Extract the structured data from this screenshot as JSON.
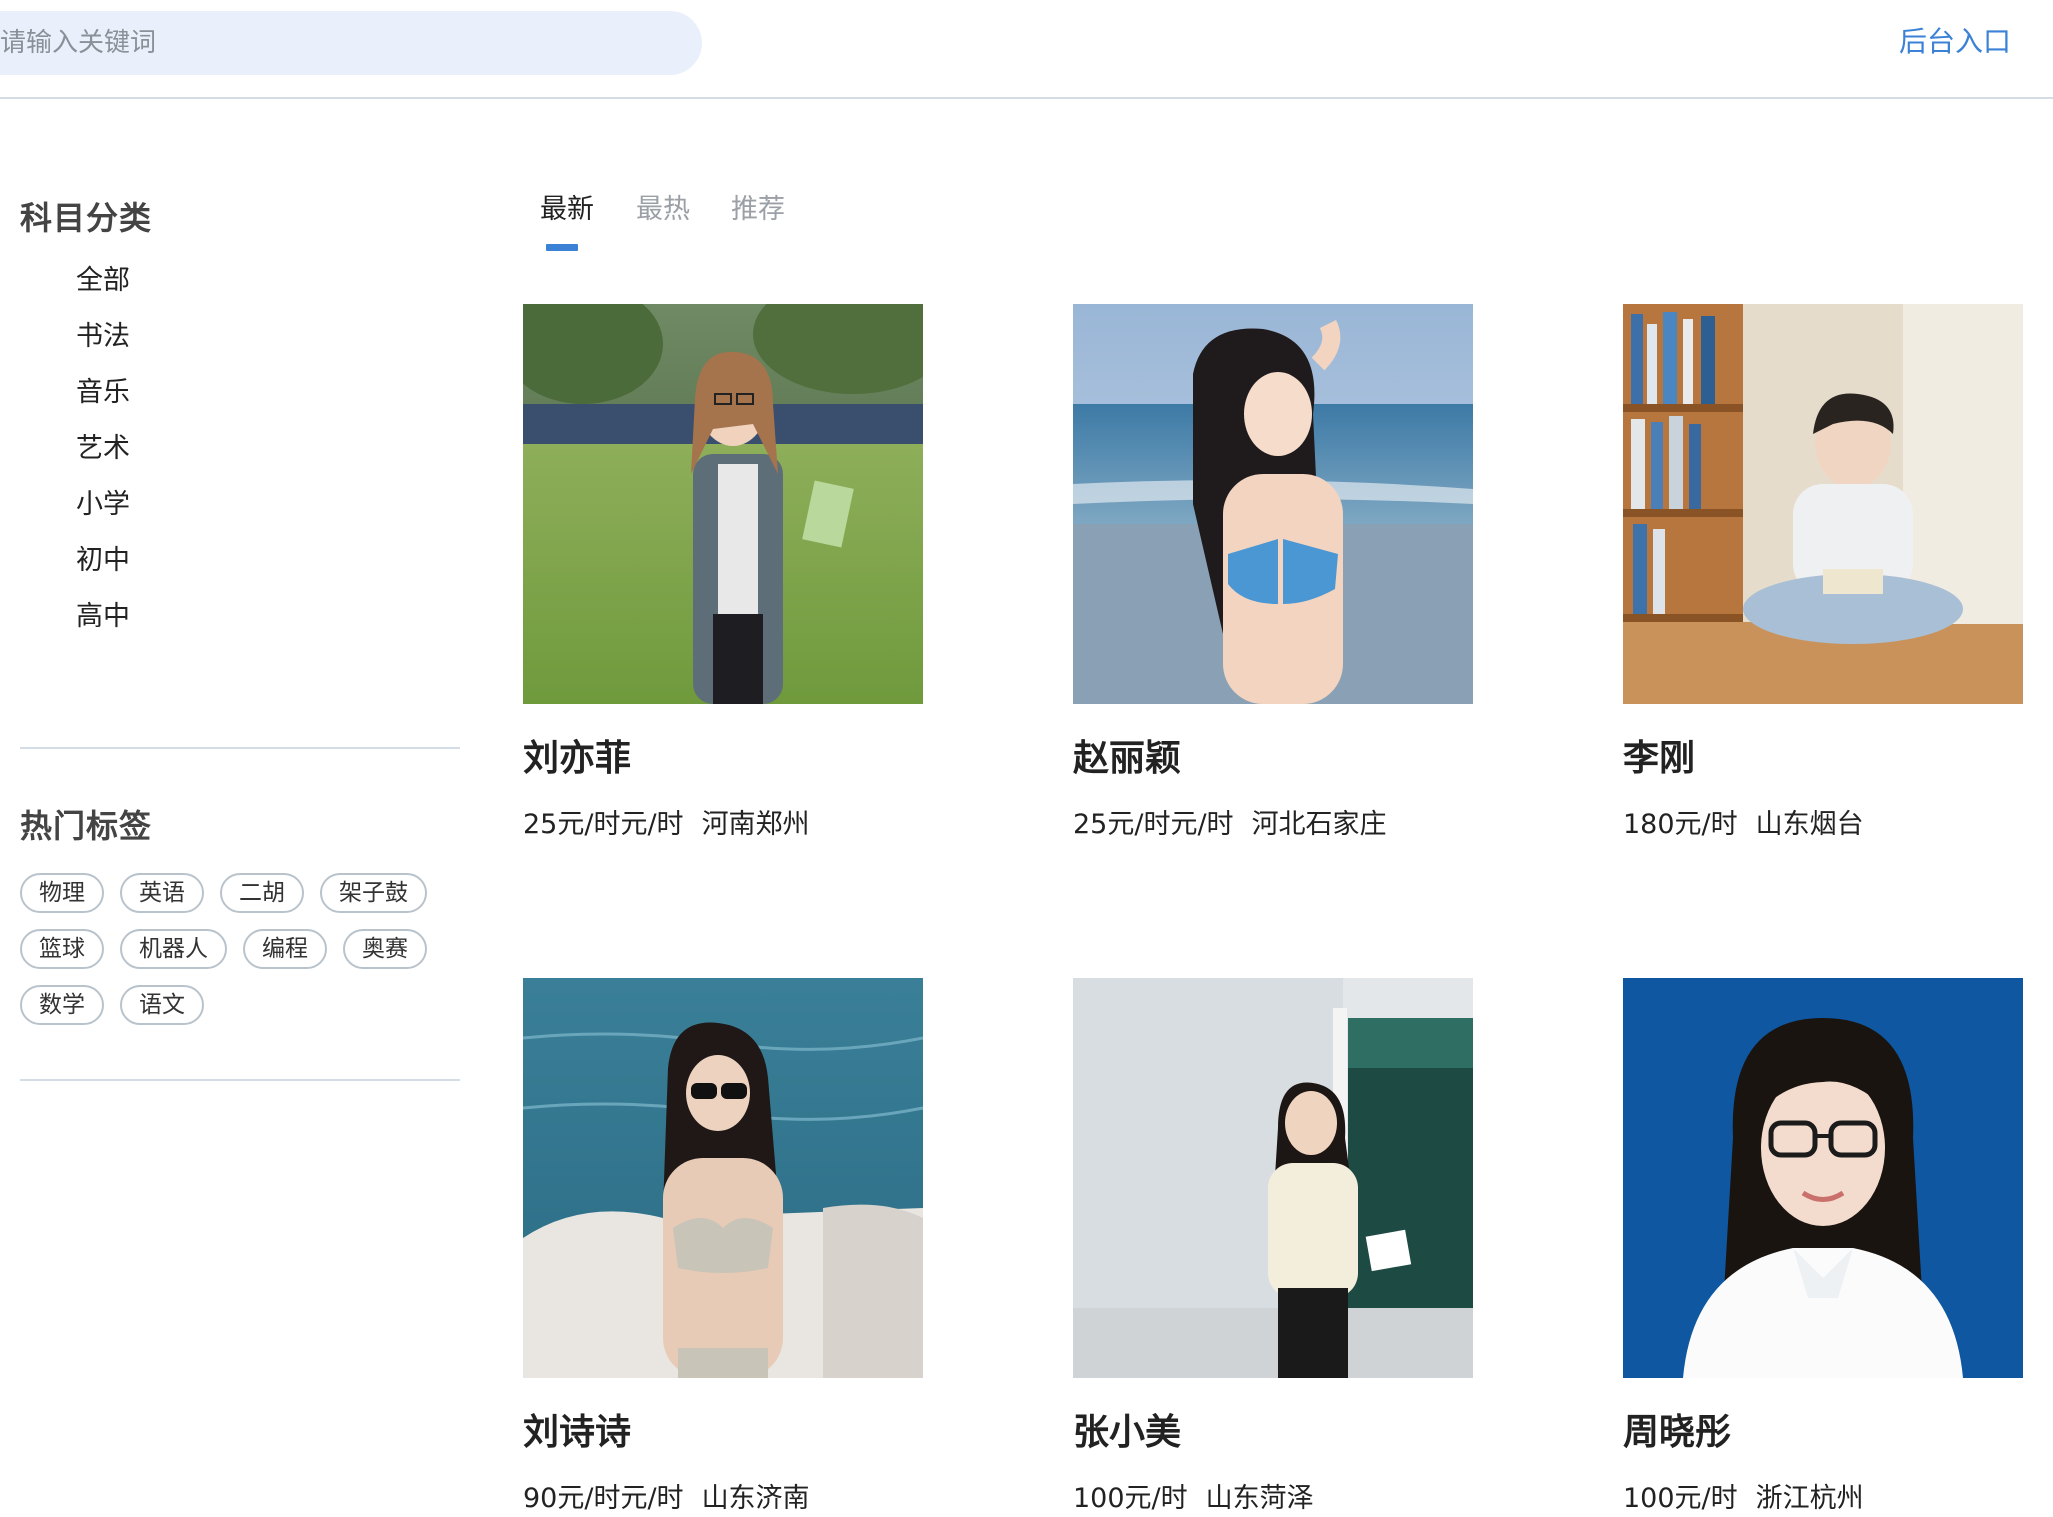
{
  "header": {
    "search_placeholder": "请输入关键词",
    "admin_link": "后台入口"
  },
  "sidebar": {
    "categories_title": "科目分类",
    "categories": [
      "全部",
      "书法",
      "音乐",
      "艺术",
      "小学",
      "初中",
      "高中"
    ],
    "tags_title": "热门标签",
    "tag_rows": [
      [
        "物理",
        "英语",
        "二胡",
        "架子鼓"
      ],
      [
        "篮球",
        "机器人",
        "编程",
        "奥赛"
      ],
      [
        "数学",
        "语文"
      ]
    ]
  },
  "tabs": [
    {
      "label": "最新",
      "active": true
    },
    {
      "label": "最热",
      "active": false
    },
    {
      "label": "推荐",
      "active": false
    }
  ],
  "teachers": [
    {
      "name": "刘亦菲",
      "price": "25元/时元/时",
      "location": "河南郑州",
      "photo": "woman-on-campus-lawn"
    },
    {
      "name": "赵丽颖",
      "price": "25元/时元/时",
      "location": "河北石家庄",
      "photo": "woman-at-beach"
    },
    {
      "name": "李刚",
      "price": "180元/时",
      "location": "山东烟台",
      "photo": "man-reading-in-library"
    },
    {
      "name": "刘诗诗",
      "price": "90元/时元/时",
      "location": "山东济南",
      "photo": "woman-on-boat"
    },
    {
      "name": "张小美",
      "price": "100元/时",
      "location": "山东菏泽",
      "photo": "teacher-at-blackboard"
    },
    {
      "name": "周晓彤",
      "price": "100元/时",
      "location": "浙江杭州",
      "photo": "id-portrait-blue-background"
    }
  ],
  "colors": {
    "accent": "#3b82d6",
    "search_bg": "#e9f0fb",
    "divider": "#d4dde6"
  }
}
